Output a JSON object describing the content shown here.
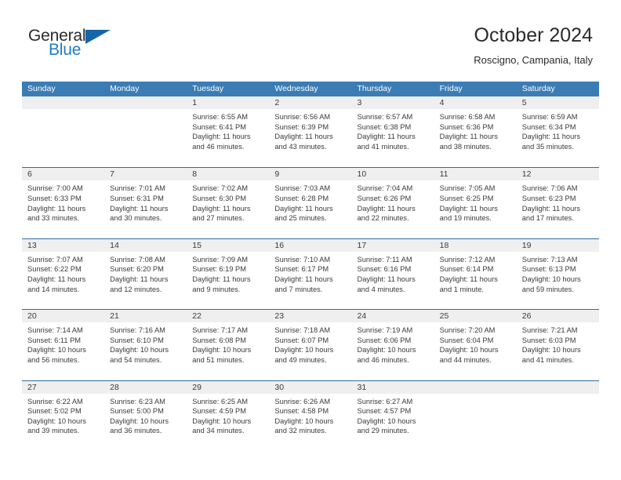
{
  "brand": {
    "word_one": "General",
    "word_two": "Blue",
    "flag_icon": "blue-triangle-flag-icon",
    "color_text": "#2b2b2b",
    "color_blue": "#1f7ec4",
    "color_flag": "#1565a8"
  },
  "header": {
    "title": "October 2024",
    "location": "Roscigno, Campania, Italy"
  },
  "theme": {
    "header_row_bg": "#3b7cb5",
    "row_divider": "#2e6da4",
    "day_band_bg": "#efefef",
    "text": "#3a3a3a",
    "page_bg": "#ffffff"
  },
  "calendar": {
    "weekday_headers": [
      "Sunday",
      "Monday",
      "Tuesday",
      "Wednesday",
      "Thursday",
      "Friday",
      "Saturday"
    ],
    "labels": {
      "sunrise": "Sunrise:",
      "sunset": "Sunset:",
      "daylight": "Daylight:"
    },
    "weeks": [
      [
        {
          "day": "",
          "empty": true
        },
        {
          "day": "",
          "empty": true
        },
        {
          "day": "1",
          "sunrise": "Sunrise: 6:55 AM",
          "sunset": "Sunset: 6:41 PM",
          "daylight_line1": "Daylight: 11 hours",
          "daylight_line2": "and 46 minutes."
        },
        {
          "day": "2",
          "sunrise": "Sunrise: 6:56 AM",
          "sunset": "Sunset: 6:39 PM",
          "daylight_line1": "Daylight: 11 hours",
          "daylight_line2": "and 43 minutes."
        },
        {
          "day": "3",
          "sunrise": "Sunrise: 6:57 AM",
          "sunset": "Sunset: 6:38 PM",
          "daylight_line1": "Daylight: 11 hours",
          "daylight_line2": "and 41 minutes."
        },
        {
          "day": "4",
          "sunrise": "Sunrise: 6:58 AM",
          "sunset": "Sunset: 6:36 PM",
          "daylight_line1": "Daylight: 11 hours",
          "daylight_line2": "and 38 minutes."
        },
        {
          "day": "5",
          "sunrise": "Sunrise: 6:59 AM",
          "sunset": "Sunset: 6:34 PM",
          "daylight_line1": "Daylight: 11 hours",
          "daylight_line2": "and 35 minutes."
        }
      ],
      [
        {
          "day": "6",
          "sunrise": "Sunrise: 7:00 AM",
          "sunset": "Sunset: 6:33 PM",
          "daylight_line1": "Daylight: 11 hours",
          "daylight_line2": "and 33 minutes."
        },
        {
          "day": "7",
          "sunrise": "Sunrise: 7:01 AM",
          "sunset": "Sunset: 6:31 PM",
          "daylight_line1": "Daylight: 11 hours",
          "daylight_line2": "and 30 minutes."
        },
        {
          "day": "8",
          "sunrise": "Sunrise: 7:02 AM",
          "sunset": "Sunset: 6:30 PM",
          "daylight_line1": "Daylight: 11 hours",
          "daylight_line2": "and 27 minutes."
        },
        {
          "day": "9",
          "sunrise": "Sunrise: 7:03 AM",
          "sunset": "Sunset: 6:28 PM",
          "daylight_line1": "Daylight: 11 hours",
          "daylight_line2": "and 25 minutes."
        },
        {
          "day": "10",
          "sunrise": "Sunrise: 7:04 AM",
          "sunset": "Sunset: 6:26 PM",
          "daylight_line1": "Daylight: 11 hours",
          "daylight_line2": "and 22 minutes."
        },
        {
          "day": "11",
          "sunrise": "Sunrise: 7:05 AM",
          "sunset": "Sunset: 6:25 PM",
          "daylight_line1": "Daylight: 11 hours",
          "daylight_line2": "and 19 minutes."
        },
        {
          "day": "12",
          "sunrise": "Sunrise: 7:06 AM",
          "sunset": "Sunset: 6:23 PM",
          "daylight_line1": "Daylight: 11 hours",
          "daylight_line2": "and 17 minutes."
        }
      ],
      [
        {
          "day": "13",
          "sunrise": "Sunrise: 7:07 AM",
          "sunset": "Sunset: 6:22 PM",
          "daylight_line1": "Daylight: 11 hours",
          "daylight_line2": "and 14 minutes."
        },
        {
          "day": "14",
          "sunrise": "Sunrise: 7:08 AM",
          "sunset": "Sunset: 6:20 PM",
          "daylight_line1": "Daylight: 11 hours",
          "daylight_line2": "and 12 minutes."
        },
        {
          "day": "15",
          "sunrise": "Sunrise: 7:09 AM",
          "sunset": "Sunset: 6:19 PM",
          "daylight_line1": "Daylight: 11 hours",
          "daylight_line2": "and 9 minutes."
        },
        {
          "day": "16",
          "sunrise": "Sunrise: 7:10 AM",
          "sunset": "Sunset: 6:17 PM",
          "daylight_line1": "Daylight: 11 hours",
          "daylight_line2": "and 7 minutes."
        },
        {
          "day": "17",
          "sunrise": "Sunrise: 7:11 AM",
          "sunset": "Sunset: 6:16 PM",
          "daylight_line1": "Daylight: 11 hours",
          "daylight_line2": "and 4 minutes."
        },
        {
          "day": "18",
          "sunrise": "Sunrise: 7:12 AM",
          "sunset": "Sunset: 6:14 PM",
          "daylight_line1": "Daylight: 11 hours",
          "daylight_line2": "and 1 minute."
        },
        {
          "day": "19",
          "sunrise": "Sunrise: 7:13 AM",
          "sunset": "Sunset: 6:13 PM",
          "daylight_line1": "Daylight: 10 hours",
          "daylight_line2": "and 59 minutes."
        }
      ],
      [
        {
          "day": "20",
          "sunrise": "Sunrise: 7:14 AM",
          "sunset": "Sunset: 6:11 PM",
          "daylight_line1": "Daylight: 10 hours",
          "daylight_line2": "and 56 minutes."
        },
        {
          "day": "21",
          "sunrise": "Sunrise: 7:16 AM",
          "sunset": "Sunset: 6:10 PM",
          "daylight_line1": "Daylight: 10 hours",
          "daylight_line2": "and 54 minutes."
        },
        {
          "day": "22",
          "sunrise": "Sunrise: 7:17 AM",
          "sunset": "Sunset: 6:08 PM",
          "daylight_line1": "Daylight: 10 hours",
          "daylight_line2": "and 51 minutes."
        },
        {
          "day": "23",
          "sunrise": "Sunrise: 7:18 AM",
          "sunset": "Sunset: 6:07 PM",
          "daylight_line1": "Daylight: 10 hours",
          "daylight_line2": "and 49 minutes."
        },
        {
          "day": "24",
          "sunrise": "Sunrise: 7:19 AM",
          "sunset": "Sunset: 6:06 PM",
          "daylight_line1": "Daylight: 10 hours",
          "daylight_line2": "and 46 minutes."
        },
        {
          "day": "25",
          "sunrise": "Sunrise: 7:20 AM",
          "sunset": "Sunset: 6:04 PM",
          "daylight_line1": "Daylight: 10 hours",
          "daylight_line2": "and 44 minutes."
        },
        {
          "day": "26",
          "sunrise": "Sunrise: 7:21 AM",
          "sunset": "Sunset: 6:03 PM",
          "daylight_line1": "Daylight: 10 hours",
          "daylight_line2": "and 41 minutes."
        }
      ],
      [
        {
          "day": "27",
          "sunrise": "Sunrise: 6:22 AM",
          "sunset": "Sunset: 5:02 PM",
          "daylight_line1": "Daylight: 10 hours",
          "daylight_line2": "and 39 minutes."
        },
        {
          "day": "28",
          "sunrise": "Sunrise: 6:23 AM",
          "sunset": "Sunset: 5:00 PM",
          "daylight_line1": "Daylight: 10 hours",
          "daylight_line2": "and 36 minutes."
        },
        {
          "day": "29",
          "sunrise": "Sunrise: 6:25 AM",
          "sunset": "Sunset: 4:59 PM",
          "daylight_line1": "Daylight: 10 hours",
          "daylight_line2": "and 34 minutes."
        },
        {
          "day": "30",
          "sunrise": "Sunrise: 6:26 AM",
          "sunset": "Sunset: 4:58 PM",
          "daylight_line1": "Daylight: 10 hours",
          "daylight_line2": "and 32 minutes."
        },
        {
          "day": "31",
          "sunrise": "Sunrise: 6:27 AM",
          "sunset": "Sunset: 4:57 PM",
          "daylight_line1": "Daylight: 10 hours",
          "daylight_line2": "and 29 minutes."
        },
        {
          "day": "",
          "empty": true
        },
        {
          "day": "",
          "empty": true
        }
      ]
    ]
  }
}
